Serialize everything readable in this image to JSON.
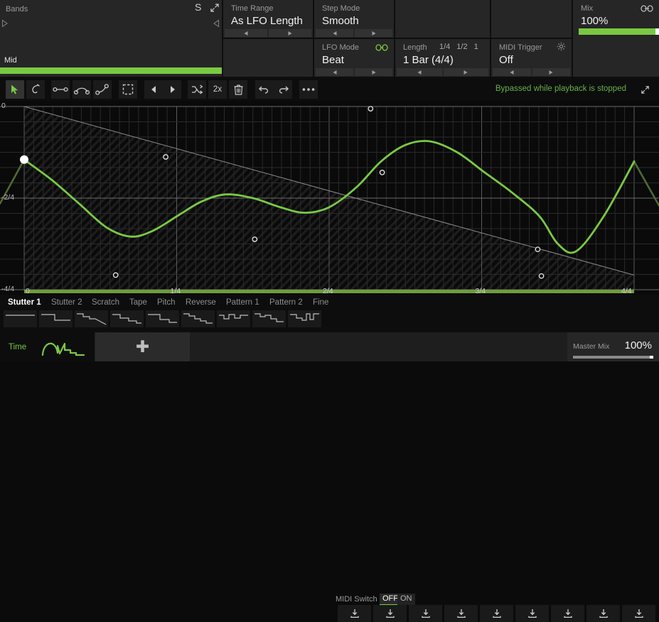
{
  "bands": {
    "title": "Bands",
    "solo_label": "S",
    "expand_icon": "expand-icon",
    "left_arrow_icon": "triangle-right-icon",
    "right_arrow_icon": "triangle-left-icon",
    "band_name": "Mid",
    "band_color": "#7ac943"
  },
  "controls": {
    "time_range": {
      "title": "Time Range",
      "value": "As LFO Length"
    },
    "step_mode": {
      "title": "Step Mode",
      "value": "Smooth"
    },
    "lfo_mode": {
      "title": "LFO Mode",
      "value": "Beat",
      "link_icon": "link-icon"
    },
    "length": {
      "title": "Length",
      "value": "1 Bar (4/4)",
      "quick": [
        "1/4",
        "1/2",
        "1"
      ]
    },
    "midi_trigger": {
      "title": "MIDI Trigger",
      "value": "Off",
      "gear_icon": "gear-icon"
    },
    "mix": {
      "title": "Mix",
      "value": "100%",
      "link_icon": "link-icon",
      "fill_pct": 96
    }
  },
  "toolbar": {
    "tools": [
      {
        "name": "pointer-tool",
        "icon": "cursor-arrow-icon",
        "active": true
      },
      {
        "name": "pen-tool",
        "icon": "pen-curve-icon",
        "active": false
      },
      {
        "name": "line-segment-tool",
        "icon": "line-segment-icon",
        "active": false
      },
      {
        "name": "arc-segment-tool",
        "icon": "arc-segment-icon",
        "active": false
      },
      {
        "name": "curve-segment-tool",
        "icon": "curve-point-icon",
        "active": false
      },
      {
        "name": "marquee-select-tool",
        "icon": "dashed-rect-icon",
        "active": false
      },
      {
        "name": "nudge-left-button",
        "icon": "triangle-left-icon",
        "active": false
      },
      {
        "name": "nudge-right-button",
        "icon": "triangle-right-icon",
        "active": false
      },
      {
        "name": "randomize-button",
        "icon": "shuffle-icon",
        "active": false
      },
      {
        "name": "double-rate-button",
        "icon": "2x-text-icon",
        "label": "2x",
        "active": false
      },
      {
        "name": "delete-button",
        "icon": "trash-icon",
        "active": false
      },
      {
        "name": "undo-button",
        "icon": "undo-arrow-icon",
        "active": false
      },
      {
        "name": "redo-button",
        "icon": "redo-arrow-icon",
        "active": false
      },
      {
        "name": "more-options-button",
        "icon": "ellipsis-icon",
        "active": false
      }
    ],
    "status": "Bypassed while playback is stopped",
    "status_color": "#66b14a",
    "expand_icon": "expand-icon"
  },
  "chart_data": {
    "type": "line",
    "title": "",
    "xlabel": "",
    "ylabel": "",
    "x_ticks": [
      "0",
      "1/4",
      "2/4",
      "3/4",
      "4/4"
    ],
    "x_tick_positions": [
      0,
      0.25,
      0.5,
      0.75,
      1.0
    ],
    "y_ticks": [
      "0",
      "-2/4",
      "-4/4"
    ],
    "y_tick_values": [
      0,
      -0.5,
      -1.0
    ],
    "xlim": [
      0,
      1
    ],
    "ylim": [
      -1,
      0
    ],
    "grid": true,
    "legend": "none",
    "curve_color": "#7ac943",
    "series": [
      {
        "name": "lfo-curve",
        "x": [
          0.0,
          0.045,
          0.09,
          0.135,
          0.175,
          0.21,
          0.25,
          0.29,
          0.33,
          0.375,
          0.42,
          0.46,
          0.5,
          0.545,
          0.585,
          0.625,
          0.665,
          0.71,
          0.755,
          0.8,
          0.845,
          0.875,
          0.905,
          0.95,
          1.0
        ],
        "y": [
          -0.29,
          -0.4,
          -0.53,
          -0.66,
          -0.71,
          -0.68,
          -0.6,
          -0.52,
          -0.48,
          -0.5,
          -0.55,
          -0.58,
          -0.55,
          -0.44,
          -0.3,
          -0.21,
          -0.19,
          -0.25,
          -0.36,
          -0.47,
          -0.6,
          -0.75,
          -0.79,
          -0.6,
          -0.3
        ]
      }
    ],
    "limit_line": {
      "name": "decay-limit-line",
      "x": [
        0,
        1
      ],
      "y": [
        0,
        -0.92
      ],
      "color": "#8c8c8c"
    },
    "handles": [
      {
        "x": 0.0,
        "y": -0.29,
        "type": "anchor-filled"
      },
      {
        "x": 0.232,
        "y": -0.275,
        "type": "handle-hollow"
      },
      {
        "x": 0.15,
        "y": -0.92,
        "type": "handle-hollow"
      },
      {
        "x": 0.378,
        "y": -0.725,
        "type": "handle-hollow"
      },
      {
        "x": 0.568,
        "y": -0.012,
        "type": "handle-hollow"
      },
      {
        "x": 0.587,
        "y": -0.36,
        "type": "handle-hollow"
      },
      {
        "x": 0.842,
        "y": -0.78,
        "type": "handle-hollow"
      },
      {
        "x": 0.848,
        "y": -0.925,
        "type": "handle-hollow"
      }
    ]
  },
  "presets": {
    "names": [
      "Stutter 1",
      "Stutter 2",
      "Scratch",
      "Tape",
      "Pitch",
      "Reverse",
      "Pattern 1",
      "Pattern 2",
      "Fine"
    ],
    "selected_index": 0,
    "download_icon": "download-icon",
    "midi_switch": {
      "label": "MIDI Switch",
      "off": "OFF",
      "on": "ON",
      "selected": "OFF"
    }
  },
  "bottom": {
    "time_tab": {
      "label": "Time",
      "icon": "lfo-waveform-icon"
    },
    "add_tab": {
      "icon": "plus-icon"
    },
    "master_mix": {
      "label": "Master Mix",
      "value": "100%",
      "fill_pct": 96
    }
  }
}
